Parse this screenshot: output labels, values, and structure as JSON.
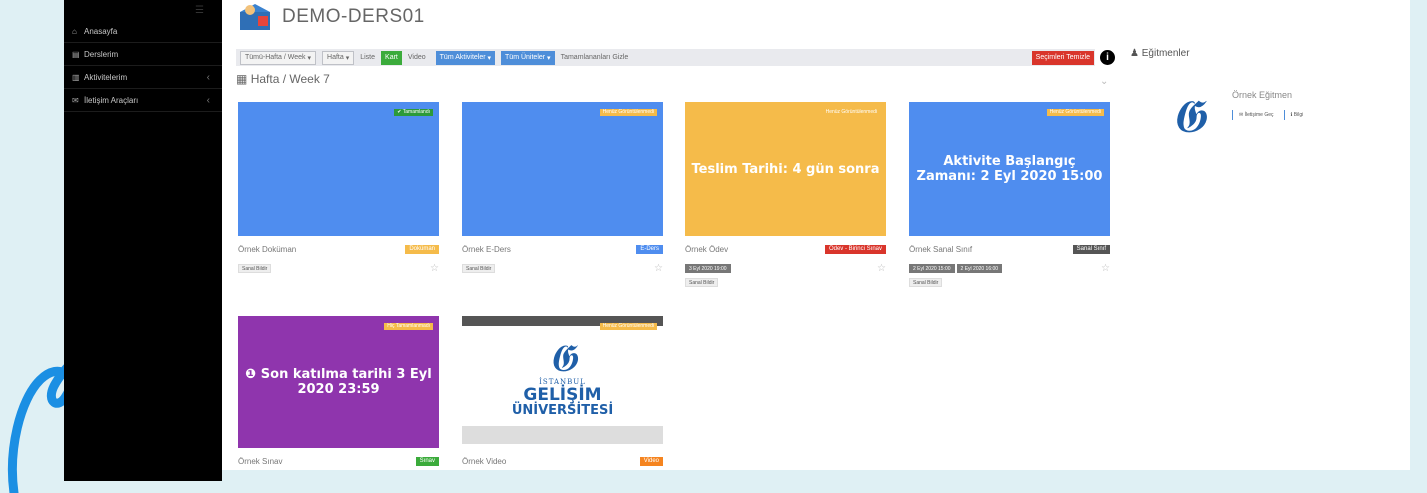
{
  "sidebar": {
    "items": [
      {
        "icon": "home-icon",
        "glyph": "⌂",
        "label": "Anasayfa",
        "chev": ""
      },
      {
        "icon": "book-icon",
        "glyph": "▤",
        "label": "Derslerim",
        "chev": ""
      },
      {
        "icon": "chart-icon",
        "glyph": "▥",
        "label": "Aktivitelerim",
        "chev": "‹"
      },
      {
        "icon": "mail-icon",
        "glyph": "✉",
        "label": "İletişim Araçları",
        "chev": "‹"
      }
    ]
  },
  "header": {
    "title": "DEMO-DERS01"
  },
  "toolbar": {
    "week_select": "Tümü-Hafta / Week",
    "week_select2": "Hafta",
    "liste": "Liste",
    "kart": "Kart",
    "video": "Video",
    "all_activities": "Tüm Aktiviteler",
    "all_units": "Tüm Üniteler",
    "hide_completed": "Tamamlananları Gizle",
    "clear_selection": "Seçimleri Temizle",
    "info": "i"
  },
  "week": {
    "title": "Hafta / Week 7"
  },
  "cards": [
    {
      "tag": "✔ Tamamlandı",
      "tag_color": "#2c9a3a",
      "big": "",
      "name": "Örnek Doküman",
      "type": "Doküman",
      "type_color": "#f5bb4a",
      "dates": [],
      "chip": "Sanal Bildir"
    },
    {
      "tag": "Henüz Görüntülenmedi",
      "tag_color": "#f5bb4a",
      "big": "",
      "name": "Örnek E-Ders",
      "type": "E-Ders",
      "type_color": "#4f8def",
      "dates": [],
      "chip": "Sanal Bildir"
    },
    {
      "tag": "Henüz Görüntülenmedi",
      "tag_color": "#f5bb4a",
      "big": "Teslim Tarihi: 4 gün sonra",
      "name": "Örnek Ödev",
      "type": "Ödev - Birinci Sınav",
      "type_color": "#d9352b",
      "dates": [
        "3 Eyl 2020 19:00"
      ],
      "chip": "Sanal Bildir"
    },
    {
      "tag": "Henüz Görüntülenmedi",
      "tag_color": "#f5bb4a",
      "big": "Aktivite Başlangıç Zamanı: 2 Eyl 2020 15:00",
      "name": "Örnek Sanal Sınıf",
      "type": "Sanal Sınıf",
      "type_color": "#555555",
      "dates": [
        "2 Eyl 2020 15:00",
        "2 Eyl 2020 16:00"
      ],
      "chip": "Sanal Bildir"
    },
    {
      "tag": "Hiç Tamamlanmadı",
      "tag_color": "#f5bb4a",
      "big": "❶ Son katılma tarihi 3 Eyl 2020 23:59",
      "name": "Örnek Sınav",
      "type": "Sınav",
      "type_color": "#3bab3b",
      "dates": [],
      "chip": ""
    },
    {
      "tag": "Henüz Görüntülenmedi",
      "tag_color": "#f5bb4a",
      "big": "",
      "name": "Örnek Video",
      "type": "Video",
      "type_color": "#f5841f",
      "dates": [],
      "chip": ""
    }
  ],
  "video_logo": {
    "line1": "İSTANBUL",
    "line2": "GELİŞİM",
    "line3": "ÜNİVERSİTESİ"
  },
  "instructors": {
    "title": "Eğitmenler",
    "name": "Örnek Eğitmen",
    "btn1": "İletişime Geç",
    "btn2": "Bilgi"
  }
}
